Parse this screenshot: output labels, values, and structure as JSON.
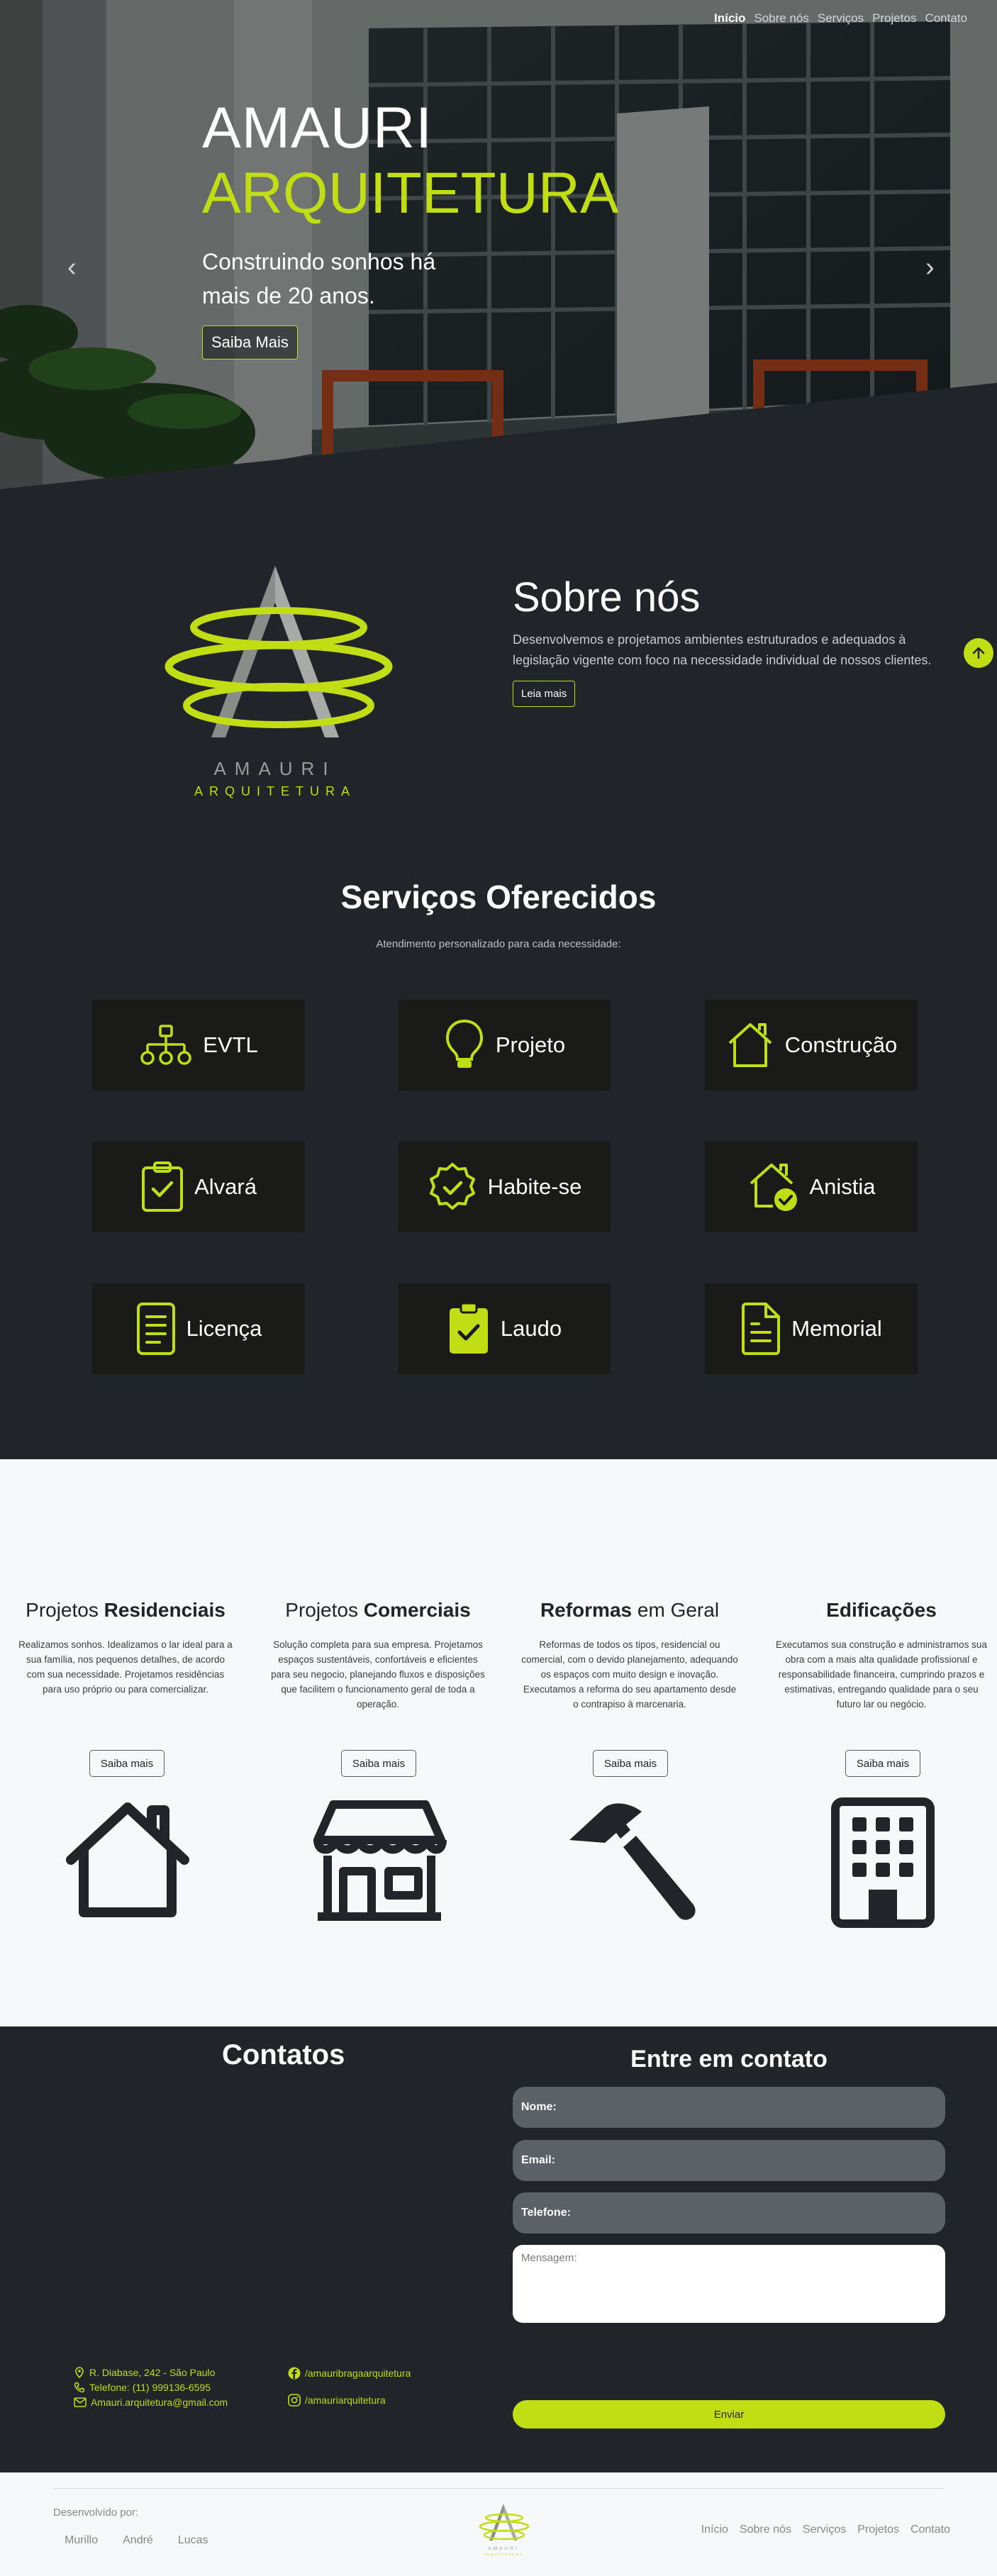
{
  "nav": {
    "items": [
      {
        "label": "Início"
      },
      {
        "label": "Sobre nós"
      },
      {
        "label": "Serviços"
      },
      {
        "label": "Projetos"
      },
      {
        "label": "Contato"
      }
    ]
  },
  "hero": {
    "title_line1": "AMAURI",
    "title_line2": "ARQUITETURA",
    "subtitle": "Construindo sonhos há mais de 20 anos.",
    "button": "Saiba Mais",
    "prev_arrow": "‹",
    "next_arrow": "›"
  },
  "about": {
    "logo_text1": "AMAURI",
    "logo_text2": "ARQUITETURA",
    "title": "Sobre nós",
    "description": "Desenvolvemos e projetamos ambientes estruturados e adequados à legislação vigente com foco na necessidade individual de nossos clientes.",
    "button": "Leia mais"
  },
  "services": {
    "title": "Serviços Oferecidos",
    "subtitle": "Atendimento personalizado para cada necessidade:",
    "items": [
      {
        "label": "EVTL",
        "icon": "hierarchy-icon"
      },
      {
        "label": "Projeto",
        "icon": "lightbulb-icon"
      },
      {
        "label": "Construção",
        "icon": "house-icon"
      },
      {
        "label": "Alvará",
        "icon": "clipboard-check-icon"
      },
      {
        "label": "Habite-se",
        "icon": "badge-check-icon"
      },
      {
        "label": "Anistia",
        "icon": "house-check-icon"
      },
      {
        "label": "Licença",
        "icon": "document-lines-icon"
      },
      {
        "label": "Laudo",
        "icon": "clipboard-filled-check-icon"
      },
      {
        "label": "Memorial",
        "icon": "file-text-icon"
      }
    ]
  },
  "projects": {
    "items": [
      {
        "title_light": "Projetos",
        "title_bold": "Residenciais",
        "description": "Realizamos sonhos. Idealizamos o lar ideal para a sua família, nos pequenos detalhes, de acordo com sua necessidade. Projetamos residências para uso próprio ou para comercializar.",
        "button": "Saiba mais",
        "icon": "house-outline-icon"
      },
      {
        "title_light": "Projetos",
        "title_bold": "Comerciais",
        "description": "Solução completa para sua empresa. Projetamos espaços sustentáveis, confortáveis e eficientes para seu negocio, planejando fluxos e disposições que facilitem o funcionamento geral de toda a operação.",
        "button": "Saiba mais",
        "icon": "storefront-icon"
      },
      {
        "title_light": "em Geral",
        "title_bold": "Reformas",
        "description": "Reformas de todos os tipos, residencial ou comercial, com o devido planejamento, adequando os espaços com muito design e inovação. Executamos a reforma do seu apartamento desde o contrapiso à marcenaria.",
        "button": "Saiba mais",
        "icon": "hammer-icon"
      },
      {
        "title_light": "",
        "title_bold": "Edificações",
        "description": "Executamos sua construção e administramos sua obra com a mais alta qualidade profissional e responsabilidade financeira, cumprindo prazos e estimativas, entregando qualidade para o seu futuro lar ou negócio.",
        "button": "Saiba mais",
        "icon": "building-icon"
      }
    ]
  },
  "contacts": {
    "title": "Contatos",
    "address": "R. Diabase, 242 - São Paulo",
    "phone": "Telefone: (11) 999136-6595",
    "email": "Amauri.arquitetura@gmail.com",
    "facebook": "/amauribragaarquitetura",
    "instagram": "/amauriarquitetura"
  },
  "form": {
    "title": "Entre em contato",
    "name_placeholder": "Nome:",
    "email_placeholder": "Email:",
    "phone_placeholder": "Telefone:",
    "message_placeholder": "Mensagem:",
    "submit": "Enviar"
  },
  "footer": {
    "developed_by": "Desenvolvido por:",
    "developers": [
      "Murillo",
      "André",
      "Lucas"
    ],
    "nav": [
      "Início",
      "Sobre nós",
      "Serviços",
      "Projetos",
      "Contato"
    ],
    "logo_text1": "AMAURI",
    "logo_text2": "ARQUITETURA"
  },
  "colors": {
    "accent": "#c1dd13",
    "background": "#212428",
    "card": "#1a1b19",
    "light_section": "#f7f8fa"
  }
}
